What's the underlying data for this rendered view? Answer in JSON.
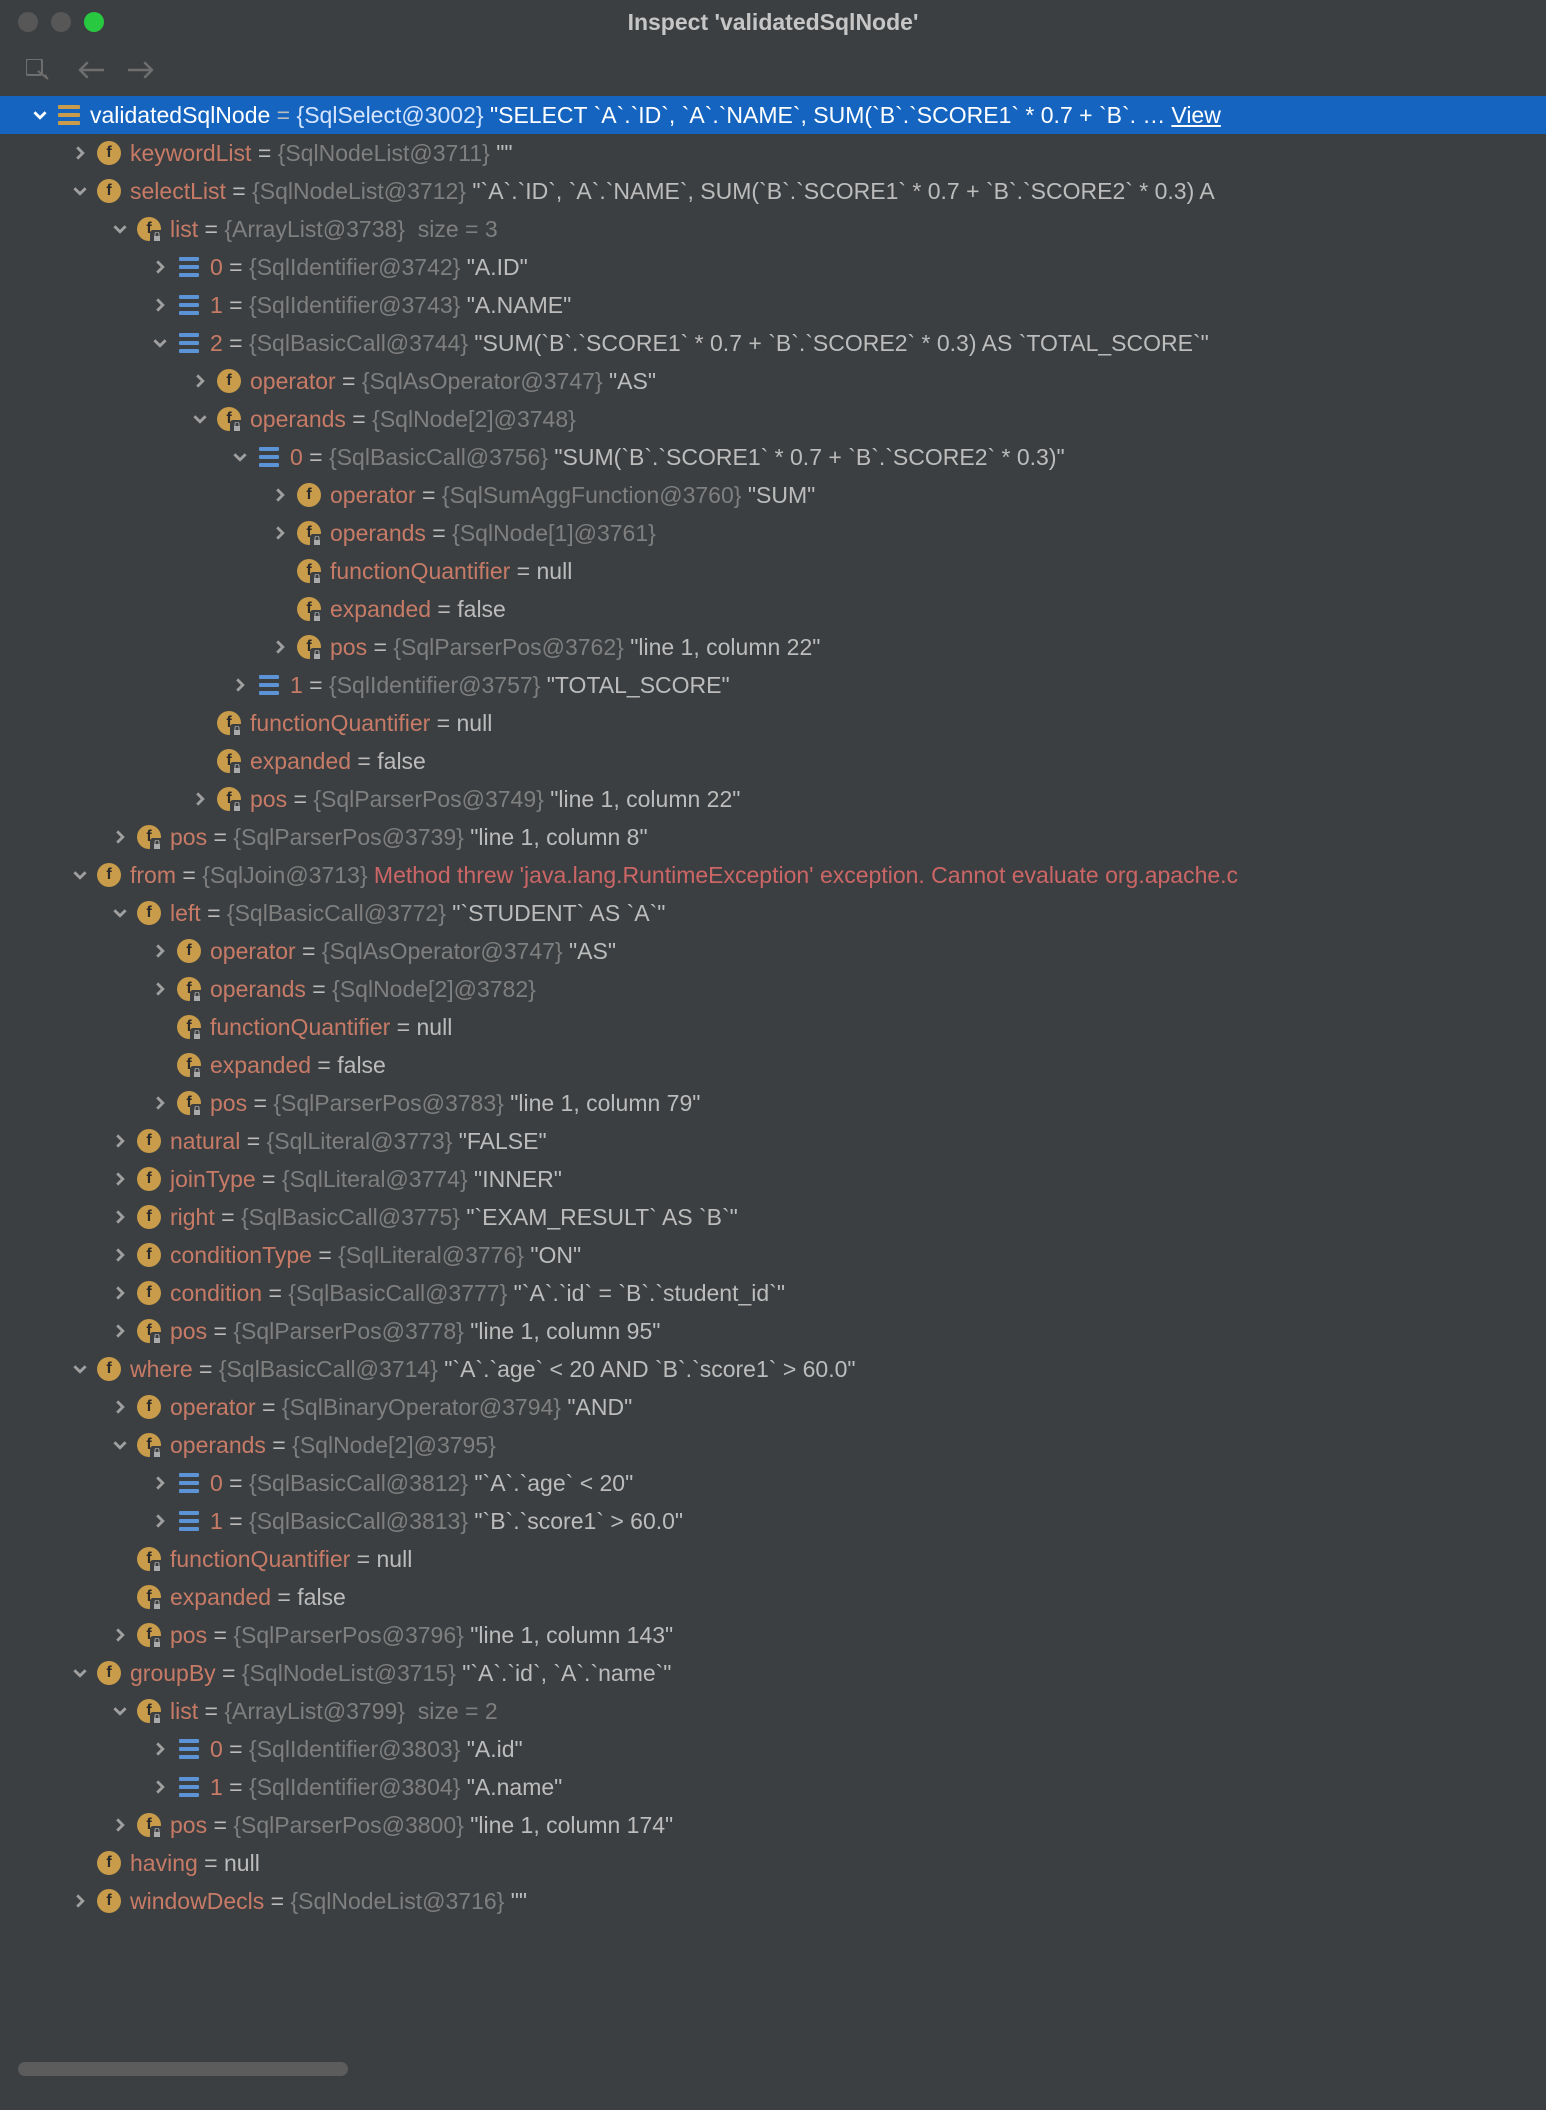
{
  "window": {
    "title": "Inspect 'validatedSqlNode'"
  },
  "root": {
    "name": "validatedSqlNode",
    "type": "{SqlSelect@3002}",
    "value": "\"SELECT `A`.`ID`, `A`.`NAME`, SUM(`B`.`SCORE1` * 0.7 + `B`. …",
    "viewLabel": "View"
  },
  "r_keywordList": {
    "name": "keywordList",
    "type": "{SqlNodeList@3711}",
    "value": "\"\""
  },
  "r_selectList": {
    "name": "selectList",
    "type": "{SqlNodeList@3712}",
    "value": "\"`A`.`ID`, `A`.`NAME`, SUM(`B`.`SCORE1` * 0.7 + `B`.`SCORE2` * 0.3) A"
  },
  "r_sl_list": {
    "name": "list",
    "type": "{ArrayList@3738}",
    "meta": "size = 3"
  },
  "r_sl_0": {
    "name": "0",
    "type": "{SqlIdentifier@3742}",
    "value": "\"A.ID\""
  },
  "r_sl_1": {
    "name": "1",
    "type": "{SqlIdentifier@3743}",
    "value": "\"A.NAME\""
  },
  "r_sl_2": {
    "name": "2",
    "type": "{SqlBasicCall@3744}",
    "value": "\"SUM(`B`.`SCORE1` * 0.7 + `B`.`SCORE2` * 0.3) AS `TOTAL_SCORE`\""
  },
  "r_sl2_op": {
    "name": "operator",
    "type": "{SqlAsOperator@3747}",
    "value": "\"AS\""
  },
  "r_sl2_ops": {
    "name": "operands",
    "type": "{SqlNode[2]@3748}"
  },
  "r_sl2_ops0": {
    "name": "0",
    "type": "{SqlBasicCall@3756}",
    "value": "\"SUM(`B`.`SCORE1` * 0.7 + `B`.`SCORE2` * 0.3)\""
  },
  "r_sl2_ops0_op": {
    "name": "operator",
    "type": "{SqlSumAggFunction@3760}",
    "value": "\"SUM\""
  },
  "r_sl2_ops0_ops": {
    "name": "operands",
    "type": "{SqlNode[1]@3761}"
  },
  "r_sl2_ops0_fq": {
    "name": "functionQuantifier",
    "value": "null"
  },
  "r_sl2_ops0_ex": {
    "name": "expanded",
    "value": "false"
  },
  "r_sl2_ops0_pos": {
    "name": "pos",
    "type": "{SqlParserPos@3762}",
    "value": "\"line 1, column 22\""
  },
  "r_sl2_ops1": {
    "name": "1",
    "type": "{SqlIdentifier@3757}",
    "value": "\"TOTAL_SCORE\""
  },
  "r_sl2_fq": {
    "name": "functionQuantifier",
    "value": "null"
  },
  "r_sl2_ex": {
    "name": "expanded",
    "value": "false"
  },
  "r_sl2_pos": {
    "name": "pos",
    "type": "{SqlParserPos@3749}",
    "value": "\"line 1, column 22\""
  },
  "r_sl_pos": {
    "name": "pos",
    "type": "{SqlParserPos@3739}",
    "value": "\"line 1, column 8\""
  },
  "r_from": {
    "name": "from",
    "type": "{SqlJoin@3713}",
    "err": "Method threw 'java.lang.RuntimeException' exception. Cannot evaluate org.apache.c"
  },
  "r_from_left": {
    "name": "left",
    "type": "{SqlBasicCall@3772}",
    "value": "\"`STUDENT` AS `A`\""
  },
  "r_fl_op": {
    "name": "operator",
    "type": "{SqlAsOperator@3747}",
    "value": "\"AS\""
  },
  "r_fl_ops": {
    "name": "operands",
    "type": "{SqlNode[2]@3782}"
  },
  "r_fl_fq": {
    "name": "functionQuantifier",
    "value": "null"
  },
  "r_fl_ex": {
    "name": "expanded",
    "value": "false"
  },
  "r_fl_pos": {
    "name": "pos",
    "type": "{SqlParserPos@3783}",
    "value": "\"line 1, column 79\""
  },
  "r_natural": {
    "name": "natural",
    "type": "{SqlLiteral@3773}",
    "value": "\"FALSE\""
  },
  "r_joinType": {
    "name": "joinType",
    "type": "{SqlLiteral@3774}",
    "value": "\"INNER\""
  },
  "r_right": {
    "name": "right",
    "type": "{SqlBasicCall@3775}",
    "value": "\"`EXAM_RESULT` AS `B`\""
  },
  "r_condType": {
    "name": "conditionType",
    "type": "{SqlLiteral@3776}",
    "value": "\"ON\""
  },
  "r_cond": {
    "name": "condition",
    "type": "{SqlBasicCall@3777}",
    "value": "\"`A`.`id` = `B`.`student_id`\""
  },
  "r_from_pos": {
    "name": "pos",
    "type": "{SqlParserPos@3778}",
    "value": "\"line 1, column 95\""
  },
  "r_where": {
    "name": "where",
    "type": "{SqlBasicCall@3714}",
    "value": "\"`A`.`age` < 20 AND `B`.`score1` > 60.0\""
  },
  "r_w_op": {
    "name": "operator",
    "type": "{SqlBinaryOperator@3794}",
    "value": "\"AND\""
  },
  "r_w_ops": {
    "name": "operands",
    "type": "{SqlNode[2]@3795}"
  },
  "r_w_0": {
    "name": "0",
    "type": "{SqlBasicCall@3812}",
    "value": "\"`A`.`age` < 20\""
  },
  "r_w_1": {
    "name": "1",
    "type": "{SqlBasicCall@3813}",
    "value": "\"`B`.`score1` > 60.0\""
  },
  "r_w_fq": {
    "name": "functionQuantifier",
    "value": "null"
  },
  "r_w_ex": {
    "name": "expanded",
    "value": "false"
  },
  "r_w_pos": {
    "name": "pos",
    "type": "{SqlParserPos@3796}",
    "value": "\"line 1, column 143\""
  },
  "r_groupBy": {
    "name": "groupBy",
    "type": "{SqlNodeList@3715}",
    "value": "\"`A`.`id`, `A`.`name`\""
  },
  "r_gb_list": {
    "name": "list",
    "type": "{ArrayList@3799}",
    "meta": "size = 2"
  },
  "r_gb_0": {
    "name": "0",
    "type": "{SqlIdentifier@3803}",
    "value": "\"A.id\""
  },
  "r_gb_1": {
    "name": "1",
    "type": "{SqlIdentifier@3804}",
    "value": "\"A.name\""
  },
  "r_gb_pos": {
    "name": "pos",
    "type": "{SqlParserPos@3800}",
    "value": "\"line 1, column 174\""
  },
  "r_having": {
    "name": "having",
    "value": "null"
  },
  "r_windowDecls": {
    "name": "windowDecls",
    "type": "{SqlNodeList@3716}",
    "value": "\"\""
  }
}
